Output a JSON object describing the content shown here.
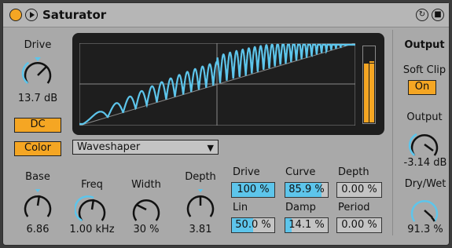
{
  "device": {
    "title": "Saturator"
  },
  "drive": {
    "label": "Drive",
    "value": "13.7 dB"
  },
  "dc_label": "DC",
  "color_label": "Color",
  "mode": {
    "selected": "Waveshaper"
  },
  "base": {
    "label": "Base",
    "value": "6.86"
  },
  "freq": {
    "label": "Freq",
    "value": "1.00 kHz"
  },
  "width": {
    "label": "Width",
    "value": "30 %"
  },
  "depth": {
    "label": "Depth",
    "value": "3.81"
  },
  "waveshaper": {
    "drive": {
      "label": "Drive",
      "value": "100 %",
      "fill": 1.0
    },
    "curve": {
      "label": "Curve",
      "value": "85.9 %",
      "fill": 0.859
    },
    "depth": {
      "label": "Depth",
      "value": "0.00 %",
      "fill": 0
    },
    "lin": {
      "label": "Lin",
      "value": "50.0 %",
      "fill": 0.5
    },
    "damp": {
      "label": "Damp",
      "value": "14.1 %",
      "fill": 0.141
    },
    "period": {
      "label": "Period",
      "value": "0.00 %",
      "fill": 0
    }
  },
  "output_section": {
    "title": "Output",
    "soft_clip_label": "Soft Clip",
    "soft_clip_value": "On",
    "output": {
      "label": "Output",
      "value": "-3.14 dB"
    },
    "dry_wet": {
      "label": "Dry/Wet",
      "value": "91.3 %"
    }
  },
  "colors": {
    "accent": "#f5a623",
    "curve": "#5dc5eb",
    "panel": "#a9a9a9",
    "display": "#1e1e1e"
  }
}
